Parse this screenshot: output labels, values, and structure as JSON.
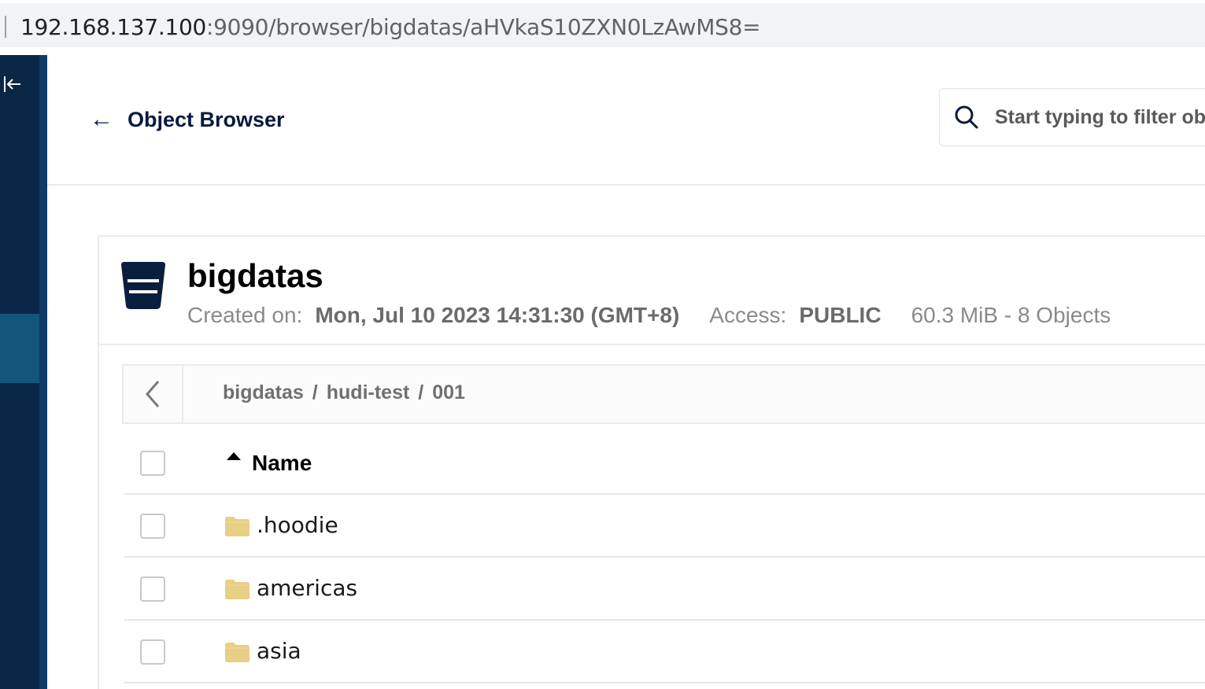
{
  "browser": {
    "url_host": "192.168.137.100",
    "url_rest": ":9090/browser/bigdatas/aHVkaS10ZXN0LzAwMS8="
  },
  "header": {
    "back_arrow": "←",
    "title": "Object Browser",
    "search_placeholder": "Start typing to filter objects"
  },
  "bucket": {
    "name": "bigdatas",
    "created_label": "Created on:",
    "created_value": "Mon, Jul 10 2023 14:31:30 (GMT+8)",
    "access_label": "Access:",
    "access_value": "PUBLIC",
    "size_summary": "60.3 MiB - 8 Objects"
  },
  "breadcrumb": {
    "parts": [
      "bigdatas",
      "hudi-test",
      "001"
    ],
    "separator": "/"
  },
  "table": {
    "name_header": "Name",
    "rows": [
      {
        "name": ".hoodie",
        "type": "folder"
      },
      {
        "name": "americas",
        "type": "folder"
      },
      {
        "name": "asia",
        "type": "folder"
      }
    ]
  },
  "colors": {
    "sidebar": "#0a2647",
    "sidebar_active": "#14557b",
    "title": "#07193e",
    "folder": "#e8cf86"
  }
}
